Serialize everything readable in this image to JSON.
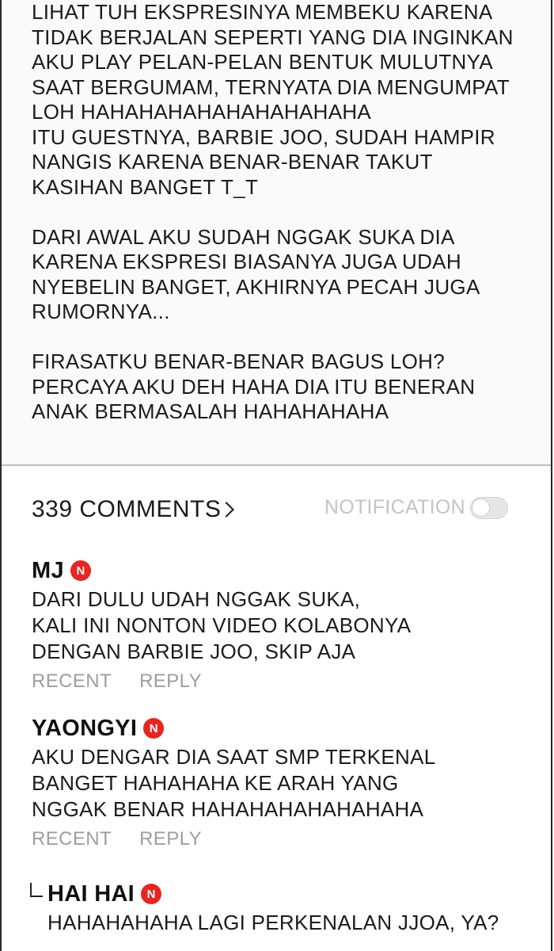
{
  "post": {
    "lines": [
      "LIHAT TUH EKSPRESINYA MEMBEKU KARENA",
      "TIDAK BERJALAN SEPERTI YANG DIA INGINKAN",
      "AKU PLAY PELAN-PELAN BENTUK MULUTNYA",
      "SAAT BERGUMAM, TERNYATA DIA MENGUMPAT",
      "LOH HAHAHAHAHAHAHAHAHAHA",
      "ITU GUESTNYA, BARBIE JOO, SUDAH HAMPIR",
      "NANGIS KARENA BENAR-BENAR TAKUT",
      "KASIHAN BANGET T_T",
      "",
      "DARI AWAL AKU SUDAH NGGAK SUKA DIA",
      "KARENA EKSPRESI BIASANYA JUGA UDAH",
      "NYEBELIN BANGET, AKHIRNYA PECAH JUGA",
      "RUMORNYA...",
      "",
      "FIRASATKU BENAR-BENAR BAGUS LOH?",
      "PERCAYA AKU DEH HAHA DIA ITU BENERAN",
      "ANAK BERMASALAH HAHAHAHAHA"
    ]
  },
  "comments_header": {
    "count_label": "339 COMMENTS",
    "notification_label": "NOTIFICATION",
    "notification_on": false
  },
  "badge_letter": "N",
  "colors": {
    "badge": "#e8251f",
    "muted": "#9e9e9e",
    "divider": "#bdbdbd"
  },
  "comments": [
    {
      "name": "MJ",
      "lines": [
        "DARI DULU UDAH NGGAK SUKA,",
        "KALI INI NONTON VIDEO KOLABONYA",
        "DENGAN BARBIE JOO, SKIP AJA"
      ],
      "recent": "RECENT",
      "reply": "REPLY"
    },
    {
      "name": "YAONGYI",
      "lines": [
        "AKU DENGAR DIA SAAT SMP TERKENAL",
        "BANGET HAHAHAHA KE ARAH YANG",
        "NGGAK BENAR HAHAHAHAHAHAHAHA"
      ],
      "recent": "RECENT",
      "reply": "REPLY"
    }
  ],
  "reply": {
    "name": "HAI HAI",
    "lines": [
      "HAHAHAHAHA LAGI PERKENALAN JJOA, YA?"
    ]
  }
}
